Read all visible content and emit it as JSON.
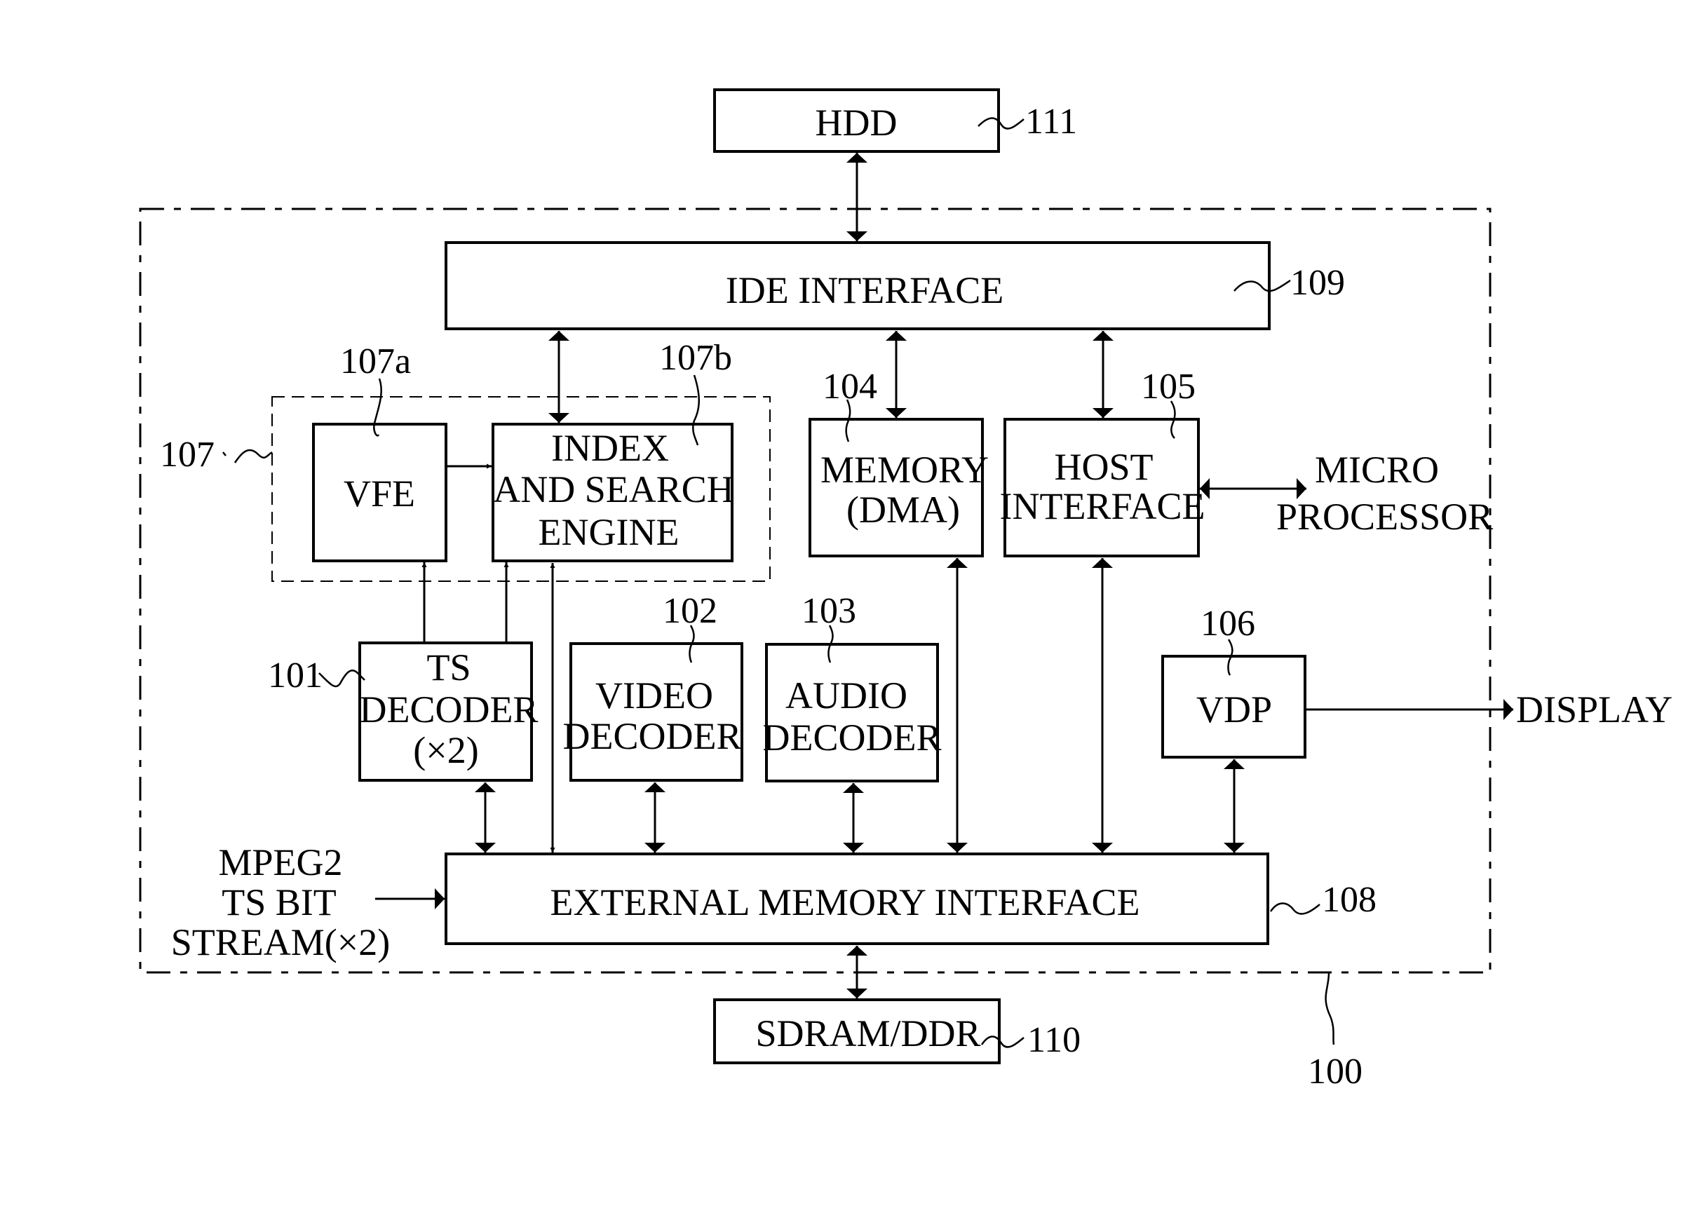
{
  "diagram": {
    "blocks": {
      "hdd": {
        "label": "HDD",
        "ref": "111"
      },
      "ide": {
        "label": "IDE INTERFACE",
        "ref": "109"
      },
      "vfe": {
        "label": "VFE",
        "ref": "107a"
      },
      "index": {
        "lines": [
          "INDEX",
          "AND SEARCH",
          "ENGINE"
        ],
        "ref": "107b"
      },
      "group107": {
        "ref": "107"
      },
      "memory": {
        "lines": [
          "MEMORY",
          "(DMA)"
        ],
        "ref": "104"
      },
      "host": {
        "lines": [
          "HOST",
          "INTERFACE"
        ],
        "ref": "105"
      },
      "ts": {
        "lines": [
          "TS",
          "DECODER",
          "(×2)"
        ],
        "ref": "101"
      },
      "video": {
        "lines": [
          "VIDEO",
          "DECODER"
        ],
        "ref": "102"
      },
      "audio": {
        "lines": [
          "AUDIO",
          "DECODER"
        ],
        "ref": "103"
      },
      "vdp": {
        "label": "VDP",
        "ref": "106"
      },
      "emi": {
        "label": "EXTERNAL MEMORY INTERFACE",
        "ref": "108"
      },
      "sdram": {
        "label": "SDRAM/DDR",
        "ref": "110"
      },
      "chip": {
        "ref": "100"
      }
    },
    "external": {
      "micro": [
        "MICRO",
        "PROCESSOR"
      ],
      "display": "DISPLAY",
      "mpeg": [
        "MPEG2",
        "TS BIT",
        "STREAM(×2)"
      ]
    }
  }
}
